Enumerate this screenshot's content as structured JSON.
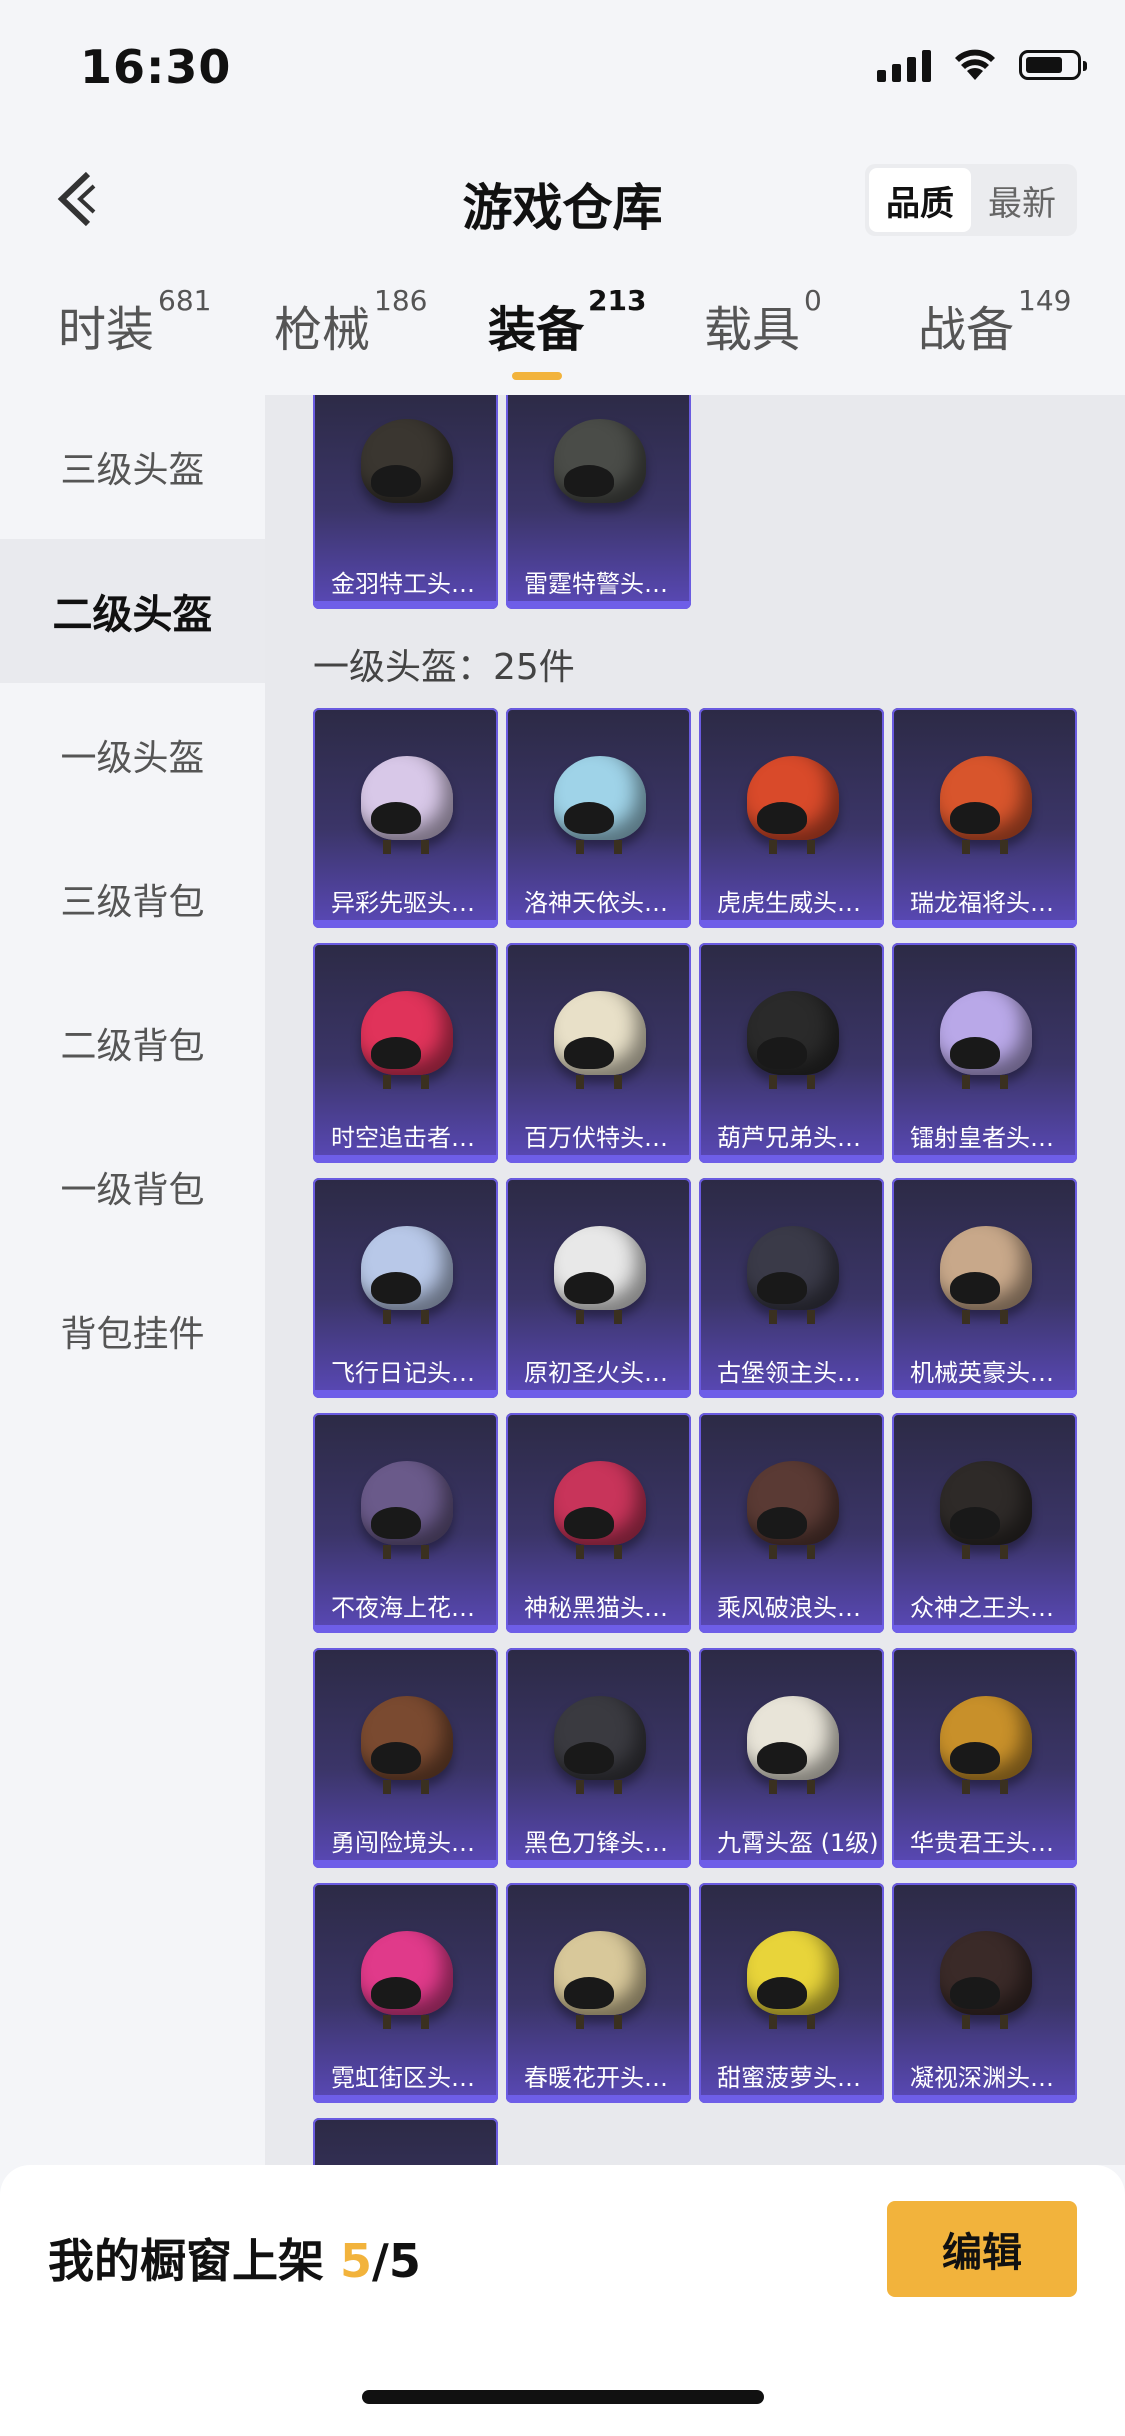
{
  "status_bar": {
    "time": "16:30"
  },
  "header": {
    "title": "游戏仓库",
    "sort_options": [
      "品质",
      "最新"
    ],
    "sort_active": "品质"
  },
  "tabs": [
    {
      "label": "时装",
      "count": "681"
    },
    {
      "label": "枪械",
      "count": "186"
    },
    {
      "label": "装备",
      "count": "213",
      "active": true
    },
    {
      "label": "载具",
      "count": "0"
    },
    {
      "label": "战备",
      "count": "149"
    }
  ],
  "sidebar": [
    {
      "label": "三级头盔"
    },
    {
      "label": "二级头盔",
      "active": true
    },
    {
      "label": "一级头盔"
    },
    {
      "label": "三级背包"
    },
    {
      "label": "二级背包"
    },
    {
      "label": "一级背包"
    },
    {
      "label": "背包挂件"
    }
  ],
  "level2_items": [
    {
      "name": "金羽特工头…"
    },
    {
      "name": "雷霆特警头…"
    }
  ],
  "level1": {
    "label": "一级头盔：25件",
    "items": [
      {
        "name": "异彩先驱头…",
        "color": "#d8c8e8"
      },
      {
        "name": "洛神天依头…",
        "color": "#9fd3e8"
      },
      {
        "name": "虎虎生威头…",
        "color": "#d94a2a"
      },
      {
        "name": "瑞龙福将头…",
        "color": "#d8552c"
      },
      {
        "name": "时空追击者…",
        "color": "#e0335a"
      },
      {
        "name": "百万伏特头…",
        "color": "#e8e0c8"
      },
      {
        "name": "葫芦兄弟头…",
        "color": "#2a2a2a"
      },
      {
        "name": "镭射皇者头…",
        "color": "#b9a8e8"
      },
      {
        "name": "飞行日记头…",
        "color": "#b8c8e8"
      },
      {
        "name": "原初圣火头…",
        "color": "#e8e8e8"
      },
      {
        "name": "古堡领主头…",
        "color": "#3a3a48"
      },
      {
        "name": "机械英豪头…",
        "color": "#c8a88a"
      },
      {
        "name": "不夜海上花…",
        "color": "#6a5a8a"
      },
      {
        "name": "神秘黑猫头…",
        "color": "#c8345a"
      },
      {
        "name": "乘风破浪头…",
        "color": "#5a3a34"
      },
      {
        "name": "众神之王头…",
        "color": "#2e2a28"
      },
      {
        "name": "勇闯险境头…",
        "color": "#7a4a30"
      },
      {
        "name": "黑色刀锋头…",
        "color": "#3a3a40"
      },
      {
        "name": "九霄头盔 (1级)",
        "color": "#e8e4d8"
      },
      {
        "name": "华贵君王头…",
        "color": "#c8902a"
      },
      {
        "name": "霓虹街区头…",
        "color": "#e03a8a"
      },
      {
        "name": "春暖花开头…",
        "color": "#d8c89a"
      },
      {
        "name": "甜蜜菠萝头…",
        "color": "#e8d43a"
      },
      {
        "name": "凝视深渊头…",
        "color": "#3a2a28"
      }
    ]
  },
  "bottom": {
    "showcase_label": "我的橱窗上架",
    "showcase_current": "5",
    "showcase_total": "/5",
    "edit_label": "编辑"
  }
}
